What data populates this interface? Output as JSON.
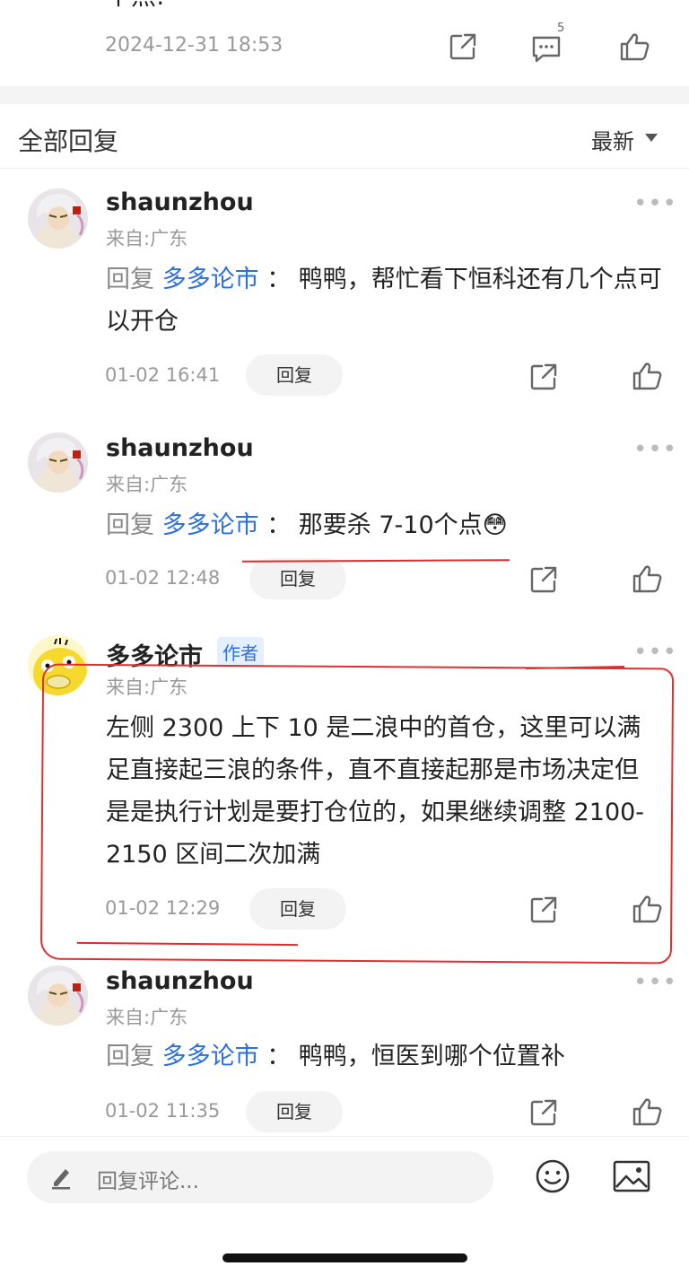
{
  "top_post": {
    "partial_text": "个点:",
    "time": "2024-12-31 18:53",
    "comment_count": "5"
  },
  "section": {
    "title": "全部回复",
    "sort_label": "最新"
  },
  "comments": [
    {
      "username": "shaunzhou",
      "location": "来自:广东",
      "reply_prefix": "回复",
      "mention": "多多论市",
      "separator": "：",
      "text": "鸭鸭，帮忙看下恒科还有几个点可以开仓",
      "time": "01-02 16:41",
      "reply_label": "回复"
    },
    {
      "username": "shaunzhou",
      "location": "来自:广东",
      "reply_prefix": "回复",
      "mention": "多多论市",
      "separator": "：",
      "text": "那要杀 7-10个点",
      "emoji": "😳",
      "time": "01-02 12:48",
      "reply_label": "回复"
    },
    {
      "username": "多多论市",
      "author_tag": "作者",
      "location": "来自:广东",
      "text": "左侧 2300 上下 10 是二浪中的首仓，这里可以满足直接起三浪的条件，直不直接起那是市场决定但是是执行计划是要打仓位的，如果继续调整 2100-2150 区间二次加满",
      "time": "01-02 12:29",
      "reply_label": "回复"
    },
    {
      "username": "shaunzhou",
      "location": "来自:广东",
      "reply_prefix": "回复",
      "mention": "多多论市",
      "separator": "：",
      "text": "鸭鸭，恒医到哪个位置补",
      "time": "01-02 11:35",
      "reply_label": "回复"
    }
  ],
  "bottom_bar": {
    "placeholder": "回复评论..."
  },
  "colors": {
    "accent": "#2b6fe0",
    "annotation": "#e02b2b",
    "muted": "#999999"
  }
}
